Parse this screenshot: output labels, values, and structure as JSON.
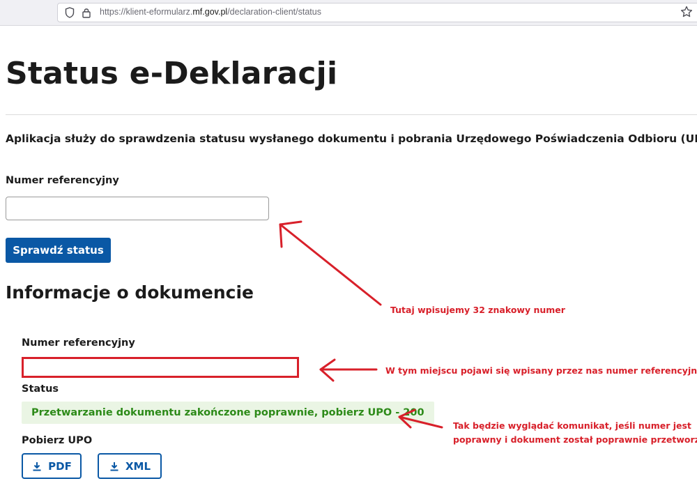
{
  "browser": {
    "url_prefix": "https://klient-eformularz.",
    "url_domain": "mf.gov.pl",
    "url_path": "/declaration-client/status",
    "icons": [
      "shield-icon",
      "lock-icon",
      "star-icon"
    ]
  },
  "page": {
    "title": "Status e-Deklaracji",
    "description": "Aplikacja służy do sprawdzenia statusu wysłanego dokumentu i pobrania Urzędowego Poświadczenia Odbioru (UPO",
    "form": {
      "label": "Numer referencyjny",
      "input_value": "",
      "button_label": "Sprawdź status"
    },
    "document_info": {
      "heading": "Informacje o dokumencie",
      "ref_label": "Numer referencyjny",
      "ref_value": "",
      "status_label": "Status",
      "status_text": "Przetwarzanie dokumentu zakończone poprawnie, pobierz UPO - 200",
      "download_label": "Pobierz UPO",
      "pdf_label": "PDF",
      "xml_label": "XML"
    }
  },
  "annotations": {
    "note_input": "Tutaj wpisujemy 32 znakowy numer",
    "note_ref": "W tym miejscu pojawi się wpisany przez nas numer referencyjny",
    "note_status_line1": "Tak będzie wyglądać komunikat, jeśli numer jest",
    "note_status_line2": "poprawny i dokument został poprawnie przetworzony"
  },
  "colors": {
    "primary": "#0a58a5",
    "status_text": "#2c8a18",
    "status_bg": "#eaf5e4",
    "annotation": "#d8202a"
  }
}
